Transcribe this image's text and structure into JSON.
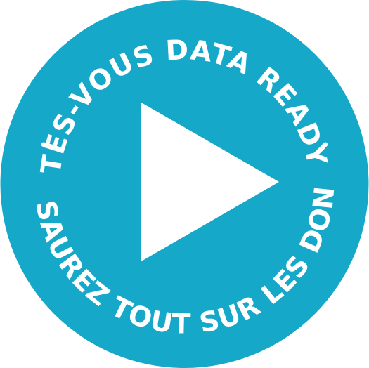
{
  "badge": {
    "top_text": "ÊTES-VOUS DATA READY ?",
    "bottom_text": "VOUS SAUREZ TOUT SUR LES DONNÉES",
    "separator_left": "•",
    "separator_right": "•"
  },
  "icons": {
    "center": "play-icon"
  },
  "colors": {
    "circle": "#16A8C9",
    "foreground": "#FFFFFF"
  }
}
